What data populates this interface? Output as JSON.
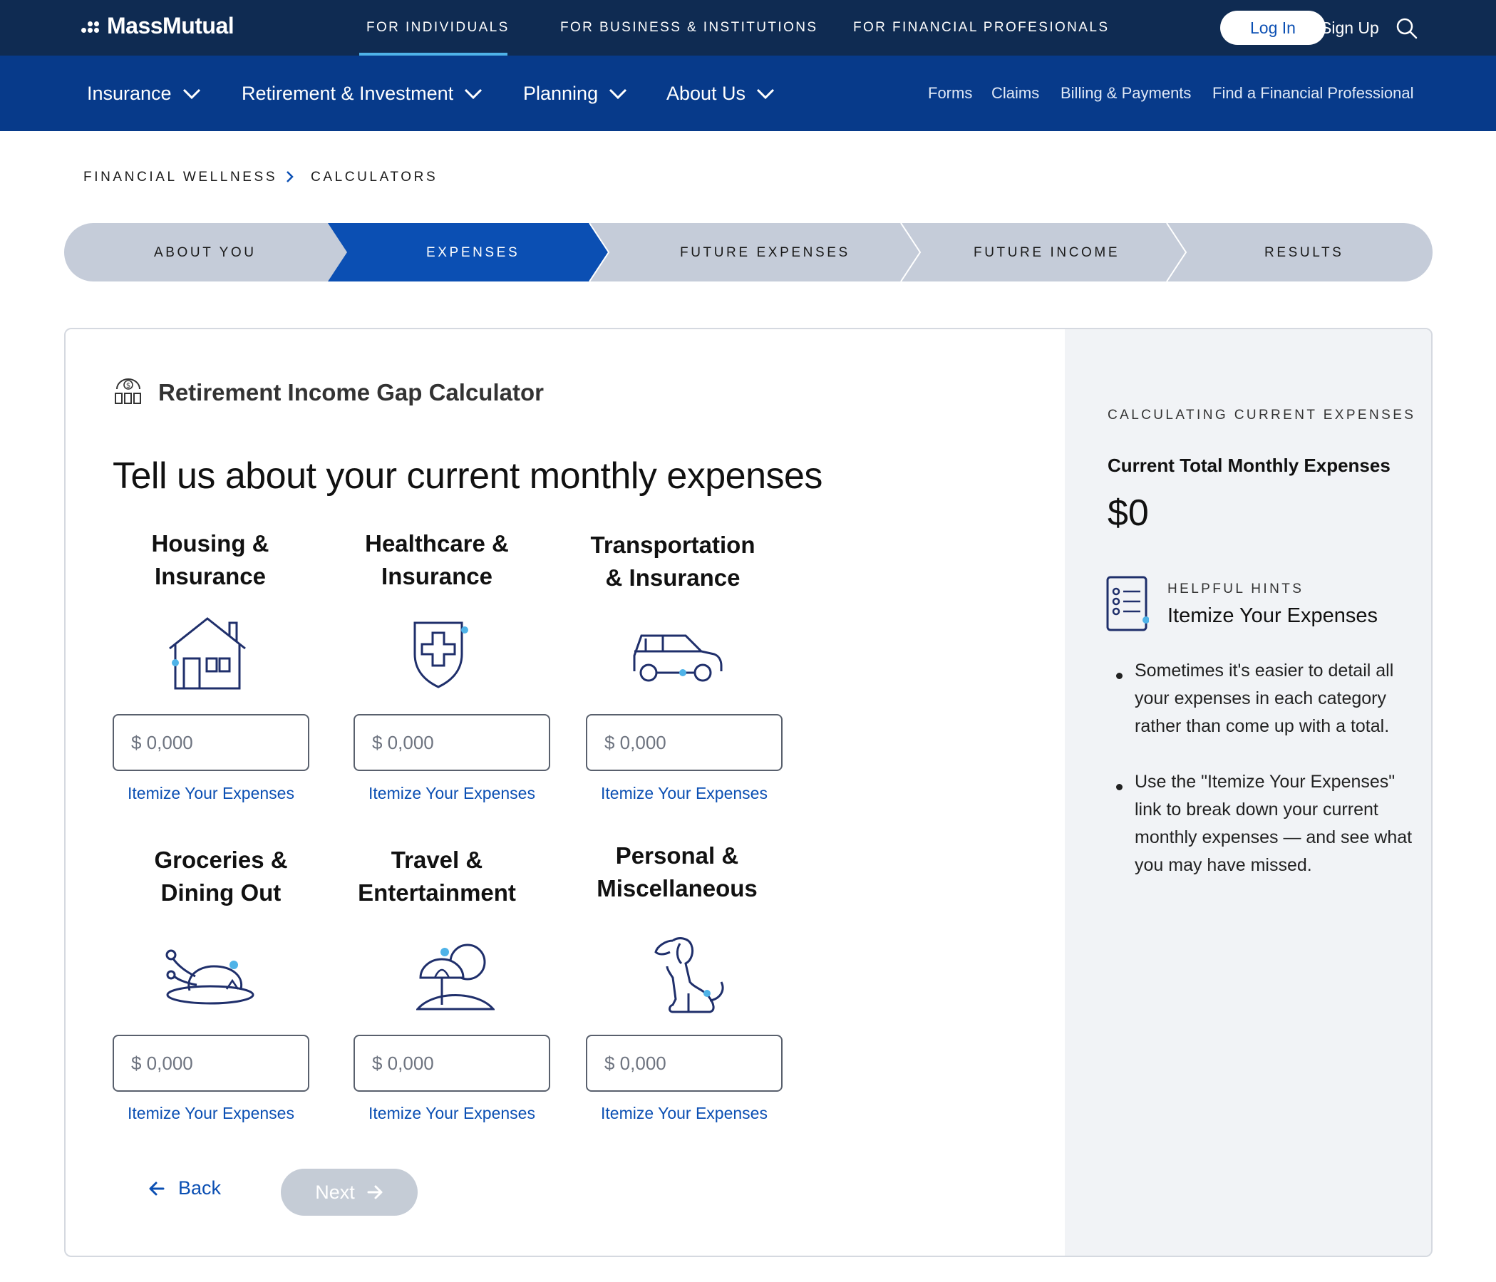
{
  "topbar": {
    "logo": "MassMutual",
    "audiences": [
      "FOR INDIVIDUALS",
      "FOR BUSINESS & INSTITUTIONS",
      "FOR FINANCIAL PROFESIONALS"
    ],
    "login": "Log In",
    "signup": "Sign Up",
    "search_icon": "search-icon"
  },
  "nav": {
    "items": [
      "Insurance",
      "Retirement & Investment",
      "Planning",
      "About Us"
    ],
    "utility": [
      "Forms",
      "Claims",
      "Billing & Payments",
      "Find a Financial Professional"
    ]
  },
  "breadcrumb": [
    "FINANCIAL WELLNESS",
    "CALCULATORS"
  ],
  "stepper": {
    "steps": [
      "ABOUT YOU",
      "EXPENSES",
      "FUTURE EXPENSES",
      "FUTURE INCOME",
      "RESULTS"
    ],
    "active_index": 1
  },
  "calculator": {
    "title": "Retirement Income Gap Calculator",
    "heading": "Tell us about your current monthly expenses",
    "categories": [
      {
        "title_line1": "Housing &",
        "title_line2": "Insurance",
        "icon": "house-icon",
        "placeholder": "$ 0,000",
        "link": "Itemize Your Expenses"
      },
      {
        "title_line1": "Healthcare &",
        "title_line2": "Insurance",
        "icon": "medical-shield-icon",
        "placeholder": "$ 0,000",
        "link": "Itemize Your Expenses"
      },
      {
        "title_line1": "Transportation",
        "title_line2": "& Insurance",
        "icon": "car-icon",
        "placeholder": "$ 0,000",
        "link": "Itemize Your Expenses"
      },
      {
        "title_line1": "Groceries &",
        "title_line2": "Dining Out",
        "icon": "roast-turkey-icon",
        "placeholder": "$ 0,000",
        "link": "Itemize Your Expenses"
      },
      {
        "title_line1": "Travel &",
        "title_line2": "Entertainment",
        "icon": "beach-umbrella-icon",
        "placeholder": "$ 0,000",
        "link": "Itemize Your Expenses"
      },
      {
        "title_line1": "Personal &",
        "title_line2": "Miscellaneous",
        "icon": "dog-icon",
        "placeholder": "$ 0,000",
        "link": "Itemize Your Expenses"
      }
    ],
    "back": "Back",
    "next": "Next"
  },
  "side": {
    "kicker": "CALCULATING CURRENT EXPENSES",
    "total_label": "Current Total Monthly Expenses",
    "total_value": "$0",
    "hint_kicker": "HELPFUL HINTS",
    "hint_title": "Itemize Your Expenses",
    "hints": [
      "Sometimes it's easier to detail all your expenses in each category rather than come up with a total.",
      "Use the \"Itemize Your Expenses\" link to break down your current monthly expenses — and see what you may have missed."
    ]
  },
  "colors": {
    "topbar": "#0f2b52",
    "navbar": "#073a8a",
    "accent_blue": "#0b4fb3",
    "active_step": "#0b4fb3",
    "inactive_step": "#c5ccd9",
    "icon_dot": "#4fb3e8"
  }
}
